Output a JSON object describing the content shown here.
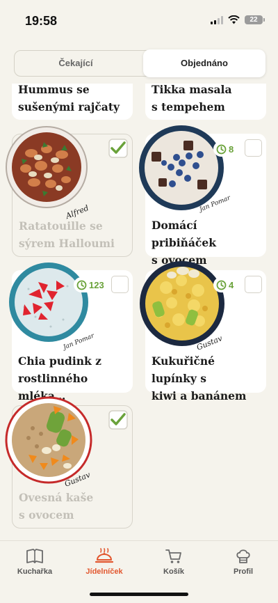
{
  "status_bar": {
    "time": "19:58",
    "battery": "22"
  },
  "segment": {
    "tabs": [
      "Čekající",
      "Objednáno"
    ],
    "active": "Objednáno"
  },
  "cards": [
    {
      "title": "Hummus se sušenými rajčaty",
      "title_lines": [
        "Hummus se",
        "sušenými rajčaty"
      ],
      "checked": false
    },
    {
      "title": "Tikka masala s tempehem",
      "title_lines": [
        "Tikka masala",
        "s tempehem"
      ],
      "checked": false
    },
    {
      "title": "Ratatouille se sýrem Halloumi",
      "title_lines": [
        "Ratatouille se",
        "sýrem Halloumi"
      ],
      "checked": true,
      "signature": "Alfred"
    },
    {
      "title": "Domácí pribiňáček s ovocem",
      "title_lines": [
        "Domácí pribiňáček",
        "s ovocem"
      ],
      "checked": false,
      "badge": "8"
    },
    {
      "title": "Chia pudink z rostlinného mléka…",
      "title_lines": [
        "Chia pudink z",
        "rostlinného mléka…"
      ],
      "checked": false,
      "badge": "123"
    },
    {
      "title": "Kukuřičné lupínky s kiwi a banánem",
      "title_lines": [
        "Kukuřičné lupínky s",
        "kiwi a banánem"
      ],
      "checked": false,
      "badge": "4",
      "signature": "Gustav"
    },
    {
      "title": "Ovesná kaše s ovocem",
      "title_lines": [
        "Ovesná kaše",
        "s ovocem"
      ],
      "checked": true,
      "signature": "Gustav"
    }
  ],
  "bottom_nav": {
    "items": [
      {
        "label": "Kuchařka",
        "icon": "book-icon"
      },
      {
        "label": "Jídelníček",
        "icon": "serving-dish-icon",
        "active": true
      },
      {
        "label": "Košík",
        "icon": "cart-icon"
      },
      {
        "label": "Profil",
        "icon": "chef-hat-icon"
      }
    ]
  },
  "colors": {
    "accent": "#e2572f",
    "badge_green": "#6aa23a",
    "background": "#f5f3ec"
  }
}
